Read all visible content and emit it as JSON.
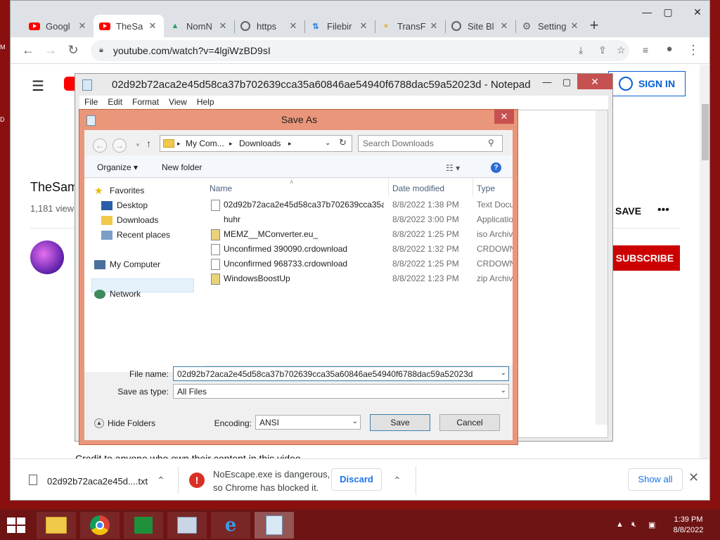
{
  "chrome": {
    "tabs": [
      {
        "title": "Googl",
        "icon": "youtube-icon"
      },
      {
        "title": "TheSa",
        "icon": "youtube-icon"
      },
      {
        "title": "NomN",
        "icon": "google-drive-icon"
      },
      {
        "title": "https",
        "icon": "globe-icon"
      },
      {
        "title": "Filebir",
        "icon": "filebin-icon"
      },
      {
        "title": "TransF",
        "icon": "transfer-icon"
      },
      {
        "title": "Site Bl",
        "icon": "globe-icon"
      },
      {
        "title": "Setting",
        "icon": "gear-icon"
      }
    ],
    "url": "youtube.com/watch?v=4lgiWzBD9sI"
  },
  "youtube": {
    "signin_label": "SIGN IN",
    "channel_title": "TheSam",
    "views": "1,181 view",
    "save_label": "SAVE",
    "more_label": "•••",
    "subscribe_label": "SUBSCRIBE",
    "description": "Credit to anyone who own their content in this video"
  },
  "downloads": {
    "file1": "02d92b72aca2e45d....txt",
    "warning_line1": "NoEscape.exe is dangerous,",
    "warning_line2": "so Chrome has blocked it.",
    "discard_label": "Discard",
    "show_all_label": "Show all"
  },
  "notepad": {
    "title": "02d92b72aca2e45d58ca37b702639cca35a60846ae54940f6788dac59a52023d - Notepad",
    "menu": [
      "File",
      "Edit",
      "Format",
      "View",
      "Help"
    ]
  },
  "save_as": {
    "title": "Save As",
    "breadcrumb": [
      "My Com...",
      "Downloads"
    ],
    "search_placeholder": "Search Downloads",
    "organize_label": "Organize ▾",
    "new_folder_label": "New folder",
    "nav": {
      "favorites": "Favorites",
      "desktop": "Desktop",
      "downloads": "Downloads",
      "recent": "Recent places",
      "my_computer": "My Computer",
      "network": "Network"
    },
    "columns": {
      "name": "Name",
      "date": "Date modified",
      "type": "Type"
    },
    "files": [
      {
        "name": "02d92b72aca2e45d58ca37b702639cca35a...",
        "date": "8/8/2022 1:38 PM",
        "type": "Text Docu"
      },
      {
        "name": "huhr",
        "date": "8/8/2022 3:00 PM",
        "type": "Applicatio"
      },
      {
        "name": "MEMZ__MConverter.eu_",
        "date": "8/8/2022 1:25 PM",
        "type": "iso Archiv"
      },
      {
        "name": "Unconfirmed 390090.crdownload",
        "date": "8/8/2022 1:32 PM",
        "type": "CRDOWN"
      },
      {
        "name": "Unconfirmed 968733.crdownload",
        "date": "8/8/2022 1:25 PM",
        "type": "CRDOWN"
      },
      {
        "name": "WindowsBoostUp",
        "date": "8/8/2022 1:23 PM",
        "type": "zip Archiv"
      }
    ],
    "file_name_label": "File name:",
    "file_name_value": "02d92b72aca2e45d58ca37b702639cca35a60846ae54940f6788dac59a52023d",
    "save_type_label": "Save as type:",
    "save_type_value": "All Files",
    "hide_folders_label": "Hide Folders",
    "encoding_label": "Encoding:",
    "encoding_value": "ANSI",
    "save_label": "Save",
    "cancel_label": "Cancel"
  },
  "taskbar": {
    "time": "1:39 PM",
    "date": "8/8/2022"
  },
  "colors": {
    "desktop": "#8a1010",
    "taskbar": "#6e1414",
    "dialog_frame": "#e9967a",
    "youtube_red": "#cc0000",
    "link_blue": "#065fd4"
  }
}
